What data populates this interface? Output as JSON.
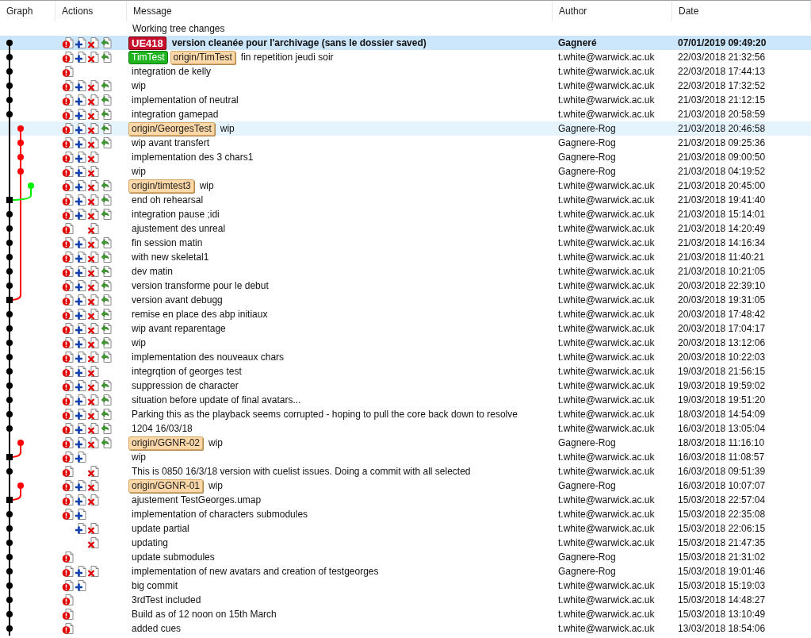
{
  "columns": [
    "Graph",
    "Actions",
    "Message",
    "Author",
    "Date"
  ],
  "working_tree": {
    "message": "Working tree changes"
  },
  "rows": [
    {
      "node": {
        "kind": "main",
        "color": "#000000"
      },
      "actions": {
        "alert": true,
        "add": true,
        "remove": true,
        "revert": true
      },
      "refs": [
        {
          "kind": "tag",
          "label": "UE418"
        }
      ],
      "message": "version cleanée pour l'archivage (sans le dossier saved)",
      "author": "Gagneré",
      "date": "07/01/2019 09:49:20",
      "selected": true,
      "hovered": false
    },
    {
      "node": {
        "kind": "main",
        "color": "#000000"
      },
      "actions": {
        "alert": true,
        "add": true,
        "remove": true,
        "revert": true
      },
      "refs": [
        {
          "kind": "local",
          "label": "TimTest"
        },
        {
          "kind": "remote",
          "label": "origin/TimTest"
        }
      ],
      "message": "fin repetition jeudi soir",
      "author": "t.white@warwick.ac.uk",
      "date": "22/03/2018 21:32:56",
      "selected": false,
      "hovered": false
    },
    {
      "node": {
        "kind": "main",
        "color": "#000000"
      },
      "actions": {
        "alert": true,
        "add": false,
        "remove": false,
        "revert": false
      },
      "message": "integration de kelly",
      "author": "t.white@warwick.ac.uk",
      "date": "22/03/2018 17:44:13",
      "selected": false,
      "hovered": false
    },
    {
      "node": {
        "kind": "main",
        "color": "#000000"
      },
      "actions": {
        "alert": true,
        "add": true,
        "remove": true,
        "revert": true
      },
      "message": "wip",
      "author": "t.white@warwick.ac.uk",
      "date": "22/03/2018 17:32:52",
      "selected": false,
      "hovered": false
    },
    {
      "node": {
        "kind": "main",
        "color": "#000000"
      },
      "actions": {
        "alert": true,
        "add": true,
        "remove": true,
        "revert": true
      },
      "message": "implementation of neutral",
      "author": "t.white@warwick.ac.uk",
      "date": "21/03/2018 21:12:15",
      "selected": false,
      "hovered": false
    },
    {
      "node": {
        "kind": "main",
        "color": "#000000"
      },
      "actions": {
        "alert": true,
        "add": true,
        "remove": true,
        "revert": true
      },
      "message": "integration gamepad",
      "author": "t.white@warwick.ac.uk",
      "date": "21/03/2018 20:58:59",
      "selected": false,
      "hovered": false
    },
    {
      "node": {
        "kind": "side",
        "color": "#ff0000"
      },
      "actions": {
        "alert": true,
        "add": true,
        "remove": true,
        "revert": true
      },
      "refs": [
        {
          "kind": "remote",
          "label": "origin/GeorgesTest"
        }
      ],
      "message": "wip",
      "author": "Gagnere-Rog",
      "date": "21/03/2018 20:46:58",
      "selected": false,
      "hovered": true
    },
    {
      "node": {
        "kind": "side",
        "color": "#ff0000"
      },
      "actions": {
        "alert": true,
        "add": true,
        "remove": true,
        "revert": true
      },
      "message": "wip avant transfert",
      "author": "Gagnere-Rog",
      "date": "21/03/2018 09:25:36",
      "selected": false,
      "hovered": false
    },
    {
      "node": {
        "kind": "side",
        "color": "#ff0000"
      },
      "actions": {
        "alert": true,
        "add": true,
        "remove": true,
        "revert": false
      },
      "message": "implementation des 3 chars1",
      "author": "Gagnere-Rog",
      "date": "21/03/2018 09:00:50",
      "selected": false,
      "hovered": false
    },
    {
      "node": {
        "kind": "side",
        "color": "#ff0000"
      },
      "actions": {
        "alert": true,
        "add": true,
        "remove": true,
        "revert": false
      },
      "message": "wip",
      "author": "Gagnere-Rog",
      "date": "21/03/2018 04:19:52",
      "selected": false,
      "hovered": false
    },
    {
      "node": {
        "kind": "side-far",
        "color": "#00ee00"
      },
      "actions": {
        "alert": true,
        "add": true,
        "remove": true,
        "revert": true
      },
      "refs": [
        {
          "kind": "remote",
          "label": "origin/timtest3"
        }
      ],
      "message": "wip",
      "author": "t.white@warwick.ac.uk",
      "date": "21/03/2018 20:45:00",
      "selected": false,
      "hovered": false
    },
    {
      "node": {
        "kind": "merge",
        "color": "#000000"
      },
      "actions": {
        "alert": true,
        "add": true,
        "remove": true,
        "revert": true
      },
      "message": "end oh rehearsal",
      "author": "t.white@warwick.ac.uk",
      "date": "21/03/2018 19:41:40",
      "selected": false,
      "hovered": false
    },
    {
      "node": {
        "kind": "main",
        "color": "#000000"
      },
      "actions": {
        "alert": true,
        "add": true,
        "remove": true,
        "revert": true
      },
      "message": "integration pause ;idi",
      "author": "t.white@warwick.ac.uk",
      "date": "21/03/2018 15:14:01",
      "selected": false,
      "hovered": false
    },
    {
      "node": {
        "kind": "main",
        "color": "#000000"
      },
      "actions": {
        "alert": true,
        "add": false,
        "remove": true,
        "revert": false
      },
      "message": "ajustement des unreal",
      "author": "t.white@warwick.ac.uk",
      "date": "21/03/2018 14:20:49",
      "selected": false,
      "hovered": false
    },
    {
      "node": {
        "kind": "main",
        "color": "#000000"
      },
      "actions": {
        "alert": true,
        "add": true,
        "remove": true,
        "revert": true
      },
      "message": "fin session matin",
      "author": "t.white@warwick.ac.uk",
      "date": "21/03/2018 14:16:34",
      "selected": false,
      "hovered": false
    },
    {
      "node": {
        "kind": "main",
        "color": "#000000"
      },
      "actions": {
        "alert": true,
        "add": true,
        "remove": true,
        "revert": true
      },
      "message": "with new skeletal1",
      "author": "t.white@warwick.ac.uk",
      "date": "21/03/2018 11:40:21",
      "selected": false,
      "hovered": false
    },
    {
      "node": {
        "kind": "main",
        "color": "#000000"
      },
      "actions": {
        "alert": true,
        "add": true,
        "remove": true,
        "revert": true
      },
      "message": "dev matin",
      "author": "t.white@warwick.ac.uk",
      "date": "21/03/2018 10:21:05",
      "selected": false,
      "hovered": false
    },
    {
      "node": {
        "kind": "main",
        "color": "#000000"
      },
      "actions": {
        "alert": true,
        "add": true,
        "remove": true,
        "revert": true
      },
      "message": "version transforme pour le debut",
      "author": "t.white@warwick.ac.uk",
      "date": "20/03/2018 22:39:10",
      "selected": false,
      "hovered": false
    },
    {
      "node": {
        "kind": "merge",
        "color": "#000000"
      },
      "actions": {
        "alert": true,
        "add": true,
        "remove": true,
        "revert": true
      },
      "message": "version avant debugg",
      "author": "t.white@warwick.ac.uk",
      "date": "20/03/2018 19:31:05",
      "selected": false,
      "hovered": false
    },
    {
      "node": {
        "kind": "main",
        "color": "#000000"
      },
      "actions": {
        "alert": true,
        "add": true,
        "remove": true,
        "revert": true
      },
      "message": "remise en place des abp initiaux",
      "author": "t.white@warwick.ac.uk",
      "date": "20/03/2018 17:48:42",
      "selected": false,
      "hovered": false
    },
    {
      "node": {
        "kind": "main",
        "color": "#000000"
      },
      "actions": {
        "alert": true,
        "add": true,
        "remove": true,
        "revert": true
      },
      "message": "wip avant reparentage",
      "author": "t.white@warwick.ac.uk",
      "date": "20/03/2018 17:04:17",
      "selected": false,
      "hovered": false
    },
    {
      "node": {
        "kind": "main",
        "color": "#000000"
      },
      "actions": {
        "alert": true,
        "add": true,
        "remove": true,
        "revert": true
      },
      "message": "wip",
      "author": "t.white@warwick.ac.uk",
      "date": "20/03/2018 13:12:06",
      "selected": false,
      "hovered": false
    },
    {
      "node": {
        "kind": "main",
        "color": "#000000"
      },
      "actions": {
        "alert": true,
        "add": true,
        "remove": true,
        "revert": true
      },
      "message": "implementation des nouveaux chars",
      "author": "t.white@warwick.ac.uk",
      "date": "20/03/2018 10:22:03",
      "selected": false,
      "hovered": false
    },
    {
      "node": {
        "kind": "main",
        "color": "#000000"
      },
      "actions": {
        "alert": true,
        "add": true,
        "remove": true,
        "revert": false
      },
      "message": "integrqtion of georges test",
      "author": "t.white@warwick.ac.uk",
      "date": "19/03/2018 21:56:15",
      "selected": false,
      "hovered": false
    },
    {
      "node": {
        "kind": "main",
        "color": "#000000"
      },
      "actions": {
        "alert": true,
        "add": true,
        "remove": true,
        "revert": true
      },
      "message": "suppression de character",
      "author": "t.white@warwick.ac.uk",
      "date": "19/03/2018 19:59:02",
      "selected": false,
      "hovered": false
    },
    {
      "node": {
        "kind": "main",
        "color": "#000000"
      },
      "actions": {
        "alert": true,
        "add": true,
        "remove": true,
        "revert": true
      },
      "message": "situation before update of final avatars...",
      "author": "t.white@warwick.ac.uk",
      "date": "19/03/2018 19:51:20",
      "selected": false,
      "hovered": false
    },
    {
      "node": {
        "kind": "main",
        "color": "#000000"
      },
      "actions": {
        "alert": true,
        "add": true,
        "remove": true,
        "revert": true
      },
      "message": "Parking this as the playback seems corrupted - hoping to pull the core back down to resolve",
      "author": "t.white@warwick.ac.uk",
      "date": "18/03/2018 14:54:09",
      "selected": false,
      "hovered": false
    },
    {
      "node": {
        "kind": "main",
        "color": "#000000"
      },
      "actions": {
        "alert": true,
        "add": true,
        "remove": true,
        "revert": true
      },
      "message": "1204 16/03/18",
      "author": "t.white@warwick.ac.uk",
      "date": "16/03/2018 13:05:04",
      "selected": false,
      "hovered": false
    },
    {
      "node": {
        "kind": "side",
        "color": "#ff0000"
      },
      "actions": {
        "alert": true,
        "add": true,
        "remove": true,
        "revert": true
      },
      "refs": [
        {
          "kind": "remote",
          "label": "origin/GGNR-02"
        }
      ],
      "message": "wip",
      "author": "Gagnere-Rog",
      "date": "18/03/2018 11:16:10",
      "selected": false,
      "hovered": false
    },
    {
      "node": {
        "kind": "merge",
        "color": "#000000"
      },
      "actions": {
        "alert": true,
        "add": true,
        "remove": false,
        "revert": false
      },
      "message": "wip",
      "author": "t.white@warwick.ac.uk",
      "date": "16/03/2018 11:08:57",
      "selected": false,
      "hovered": false
    },
    {
      "node": {
        "kind": "main",
        "color": "#000000"
      },
      "actions": {
        "alert": true,
        "add": false,
        "remove": true,
        "revert": false
      },
      "message": "This is 0850 16/3/18 version with cuelist issues. Doing a commit with all selected",
      "author": "t.white@warwick.ac.uk",
      "date": "16/03/2018 09:51:39",
      "selected": false,
      "hovered": false
    },
    {
      "node": {
        "kind": "side",
        "color": "#ff0000"
      },
      "actions": {
        "alert": true,
        "add": true,
        "remove": true,
        "revert": false
      },
      "refs": [
        {
          "kind": "remote",
          "label": "origin/GGNR-01"
        }
      ],
      "message": "wip",
      "author": "Gagnere-Rog",
      "date": "16/03/2018 10:07:07",
      "selected": false,
      "hovered": false
    },
    {
      "node": {
        "kind": "merge",
        "color": "#000000"
      },
      "actions": {
        "alert": true,
        "add": true,
        "remove": true,
        "revert": false
      },
      "message": "ajustement TestGeorges.umap",
      "author": "t.white@warwick.ac.uk",
      "date": "15/03/2018 22:57:04",
      "selected": false,
      "hovered": false
    },
    {
      "node": {
        "kind": "main",
        "color": "#000000"
      },
      "actions": {
        "alert": true,
        "add": true,
        "remove": false,
        "revert": false
      },
      "message": "implementation of characters submodules",
      "author": "t.white@warwick.ac.uk",
      "date": "15/03/2018 22:35:08",
      "selected": false,
      "hovered": false
    },
    {
      "node": {
        "kind": "main",
        "color": "#000000"
      },
      "actions": {
        "alert": false,
        "add": true,
        "remove": true,
        "revert": false
      },
      "message": "update partial",
      "author": "t.white@warwick.ac.uk",
      "date": "15/03/2018 22:06:15",
      "selected": false,
      "hovered": false
    },
    {
      "node": {
        "kind": "main",
        "color": "#000000"
      },
      "actions": {
        "alert": false,
        "add": false,
        "remove": true,
        "revert": false
      },
      "message": "updating",
      "author": "t.white@warwick.ac.uk",
      "date": "15/03/2018 21:47:35",
      "selected": false,
      "hovered": false
    },
    {
      "node": {
        "kind": "main",
        "color": "#000000"
      },
      "actions": {
        "alert": true,
        "add": false,
        "remove": false,
        "revert": false
      },
      "message": "update submodules",
      "author": "Gagnere-Rog",
      "date": "15/03/2018 21:31:02",
      "selected": false,
      "hovered": false
    },
    {
      "node": {
        "kind": "main",
        "color": "#000000"
      },
      "actions": {
        "alert": true,
        "add": true,
        "remove": true,
        "revert": false
      },
      "message": "implementation of new avatars and creation of testgeorges",
      "author": "Gagnere-Rog",
      "date": "15/03/2018 19:01:46",
      "selected": false,
      "hovered": false
    },
    {
      "node": {
        "kind": "main",
        "color": "#000000"
      },
      "actions": {
        "alert": true,
        "add": true,
        "remove": false,
        "revert": false
      },
      "message": "big commit",
      "author": "t.white@warwick.ac.uk",
      "date": "15/03/2018 15:19:03",
      "selected": false,
      "hovered": false
    },
    {
      "node": {
        "kind": "main",
        "color": "#000000"
      },
      "actions": {
        "alert": true,
        "add": false,
        "remove": false,
        "revert": false
      },
      "message": "3rdTest included",
      "author": "t.white@warwick.ac.uk",
      "date": "15/03/2018 14:48:27",
      "selected": false,
      "hovered": false
    },
    {
      "node": {
        "kind": "main",
        "color": "#000000"
      },
      "actions": {
        "alert": true,
        "add": false,
        "remove": false,
        "revert": false
      },
      "message": "Build as of 12 noon on 15th March",
      "author": "t.white@warwick.ac.uk",
      "date": "15/03/2018 13:10:49",
      "selected": false,
      "hovered": false
    },
    {
      "node": {
        "kind": "main",
        "color": "#000000"
      },
      "actions": {
        "alert": true,
        "add": false,
        "remove": false,
        "revert": false
      },
      "message": "added cues",
      "author": "t.white@warwick.ac.uk",
      "date": "13/03/2018 18:54:06",
      "selected": false,
      "hovered": false
    }
  ]
}
